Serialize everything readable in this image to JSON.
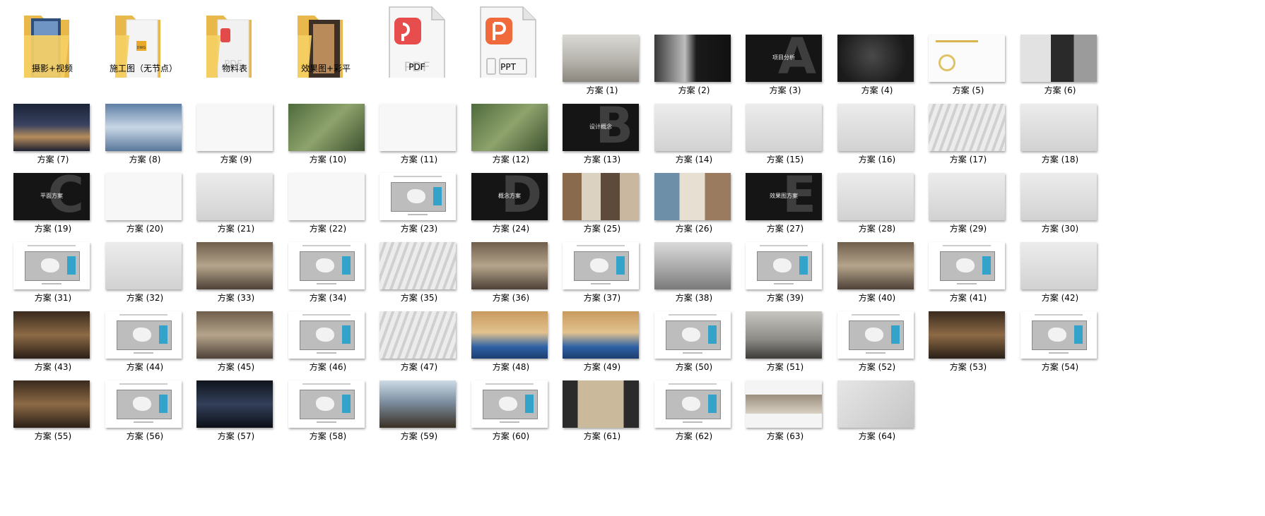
{
  "folders": [
    {
      "label": "摄影+视频",
      "icon": "folder-photo-icon"
    },
    {
      "label": "施工图（无节点）",
      "icon": "folder-dwg-icon"
    },
    {
      "label": "物料表",
      "icon": "folder-pdf-icon"
    },
    {
      "label": "效果图+彩平",
      "icon": "folder-render-icon"
    }
  ],
  "files": [
    {
      "label": "PDF",
      "icon": "pdf-file-icon",
      "badge_text": "PDF",
      "color": "#e84d4d"
    },
    {
      "label": "PPT",
      "icon": "ppt-file-icon",
      "color": "#f06a3b"
    }
  ],
  "folder_thumb_texts": {
    "dwg": "DWG",
    "pdf": "PDF"
  },
  "images": [
    {
      "label": "方案 (1)",
      "style": "t-photo1"
    },
    {
      "label": "方案 (2)",
      "style": "t-photo2"
    },
    {
      "label": "方案 (3)",
      "style": "t-dark",
      "text": "项目分析",
      "letter": "A"
    },
    {
      "label": "方案 (4)",
      "style": "t-map"
    },
    {
      "label": "方案 (5)",
      "style": "t-doc"
    },
    {
      "label": "方案 (6)",
      "style": "t-portrait"
    },
    {
      "label": "方案 (7)",
      "style": "t-city"
    },
    {
      "label": "方案 (8)",
      "style": "t-sky"
    },
    {
      "label": "方案 (9)",
      "style": "t-white"
    },
    {
      "label": "方案 (10)",
      "style": "t-aerial"
    },
    {
      "label": "方案 (11)",
      "style": "t-white"
    },
    {
      "label": "方案 (12)",
      "style": "t-aerial"
    },
    {
      "label": "方案 (13)",
      "style": "t-dark",
      "text": "设计概念",
      "letter": "B"
    },
    {
      "label": "方案 (14)",
      "style": "t-gray"
    },
    {
      "label": "方案 (15)",
      "style": "t-gray"
    },
    {
      "label": "方案 (16)",
      "style": "t-gray"
    },
    {
      "label": "方案 (17)",
      "style": "t-wave"
    },
    {
      "label": "方案 (18)",
      "style": "t-gray"
    },
    {
      "label": "方案 (19)",
      "style": "t-dark",
      "text": "平面方案",
      "letter": "C"
    },
    {
      "label": "方案 (20)",
      "style": "t-white"
    },
    {
      "label": "方案 (21)",
      "style": "t-gray"
    },
    {
      "label": "方案 (22)",
      "style": "t-white"
    },
    {
      "label": "方案 (23)",
      "style": "t-plan"
    },
    {
      "label": "方案 (24)",
      "style": "t-dark",
      "text": "概念方案",
      "letter": "D"
    },
    {
      "label": "方案 (25)",
      "style": "t-mosaic"
    },
    {
      "label": "方案 (26)",
      "style": "t-mosaic2"
    },
    {
      "label": "方案 (27)",
      "style": "t-dark",
      "text": "效果图方案",
      "letter": "E"
    },
    {
      "label": "方案 (28)",
      "style": "t-gray"
    },
    {
      "label": "方案 (29)",
      "style": "t-gray"
    },
    {
      "label": "方案 (30)",
      "style": "t-gray"
    },
    {
      "label": "方案 (31)",
      "style": "t-plan"
    },
    {
      "label": "方案 (32)",
      "style": "t-gray"
    },
    {
      "label": "方案 (33)",
      "style": "t-interior"
    },
    {
      "label": "方案 (34)",
      "style": "t-plan"
    },
    {
      "label": "方案 (35)",
      "style": "t-wave"
    },
    {
      "label": "方案 (36)",
      "style": "t-interior"
    },
    {
      "label": "方案 (37)",
      "style": "t-plan"
    },
    {
      "label": "方案 (38)",
      "style": "t-lobby"
    },
    {
      "label": "方案 (39)",
      "style": "t-plan"
    },
    {
      "label": "方案 (40)",
      "style": "t-interior"
    },
    {
      "label": "方案 (41)",
      "style": "t-plan"
    },
    {
      "label": "方案 (42)",
      "style": "t-gray"
    },
    {
      "label": "方案 (43)",
      "style": "t-warm"
    },
    {
      "label": "方案 (44)",
      "style": "t-plan"
    },
    {
      "label": "方案 (45)",
      "style": "t-interior"
    },
    {
      "label": "方案 (46)",
      "style": "t-plan"
    },
    {
      "label": "方案 (47)",
      "style": "t-wave"
    },
    {
      "label": "方案 (48)",
      "style": "t-pool"
    },
    {
      "label": "方案 (49)",
      "style": "t-pool"
    },
    {
      "label": "方案 (50)",
      "style": "t-plan"
    },
    {
      "label": "方案 (51)",
      "style": "t-gym"
    },
    {
      "label": "方案 (52)",
      "style": "t-plan"
    },
    {
      "label": "方案 (53)",
      "style": "t-warm"
    },
    {
      "label": "方案 (54)",
      "style": "t-plan"
    },
    {
      "label": "方案 (55)",
      "style": "t-warm"
    },
    {
      "label": "方案 (56)",
      "style": "t-plan"
    },
    {
      "label": "方案 (57)",
      "style": "t-night"
    },
    {
      "label": "方案 (58)",
      "style": "t-plan"
    },
    {
      "label": "方案 (59)",
      "style": "t-kids"
    },
    {
      "label": "方案 (60)",
      "style": "t-plan"
    },
    {
      "label": "方案 (61)",
      "style": "t-corr"
    },
    {
      "label": "方案 (62)",
      "style": "t-plan"
    },
    {
      "label": "方案 (63)",
      "style": "t-long"
    },
    {
      "label": "方案 (64)",
      "style": "t-end"
    }
  ]
}
